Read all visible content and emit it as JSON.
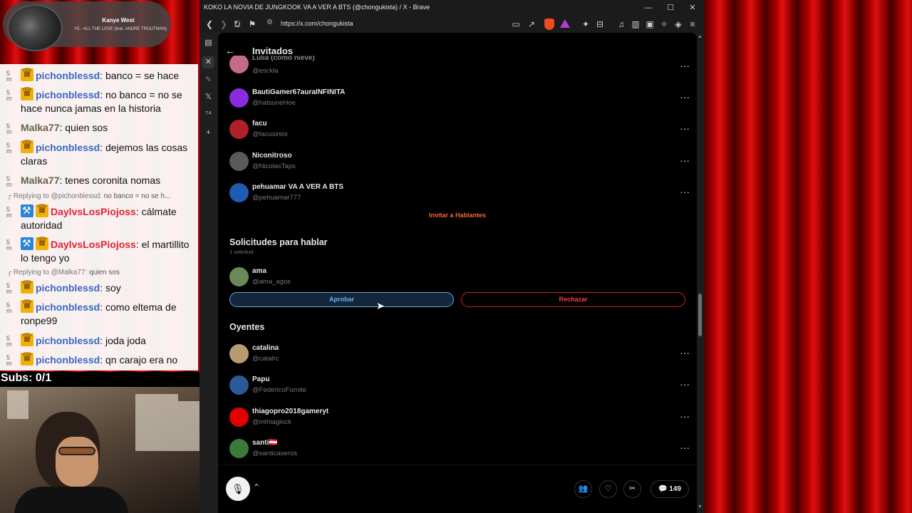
{
  "now_playing": {
    "artist": "Kanye West",
    "track": "YE - ALL THE LOVE (feat. ANDRE TROUTMAN)"
  },
  "chat": {
    "messages": [
      {
        "time": "5 m",
        "user": "pichonblessd",
        "text": "banco = se hace",
        "color": "#3a66c4",
        "badges": [
          "crown"
        ]
      },
      {
        "time": "5 m",
        "user": "pichonblessd",
        "text": "no banco = no se hace nunca jamas en la historia",
        "color": "#3a66c4",
        "badges": [
          "crown"
        ]
      },
      {
        "time": "5 m",
        "user": "Malka77",
        "text": "quien sos",
        "color": "#6b6048",
        "badges": []
      },
      {
        "time": "5 m",
        "user": "pichonblessd",
        "text": "dejemos las cosas claras",
        "color": "#3a66c4",
        "badges": [
          "crown"
        ]
      },
      {
        "time": "5 m",
        "user": "Malka77",
        "text": "tenes coronita nomas",
        "color": "#6b6048",
        "badges": []
      },
      {
        "time": "5 m",
        "user": "DaylvsLosPiojoss",
        "text": "cálmate autoridad",
        "color": "#e02233",
        "badges": [
          "hammer",
          "crown"
        ],
        "reply": {
          "prefix": "Replying to @pichonblessd:",
          "quote": "no banco = no se h..."
        }
      },
      {
        "time": "5 m",
        "user": "DaylvsLosPiojoss",
        "text": "el martillito lo tengo yo",
        "color": "#e02233",
        "badges": [
          "hammer",
          "crown"
        ]
      },
      {
        "time": "5 m",
        "user": "pichonblessd",
        "text": "soy",
        "color": "#3a66c4",
        "badges": [
          "crown"
        ],
        "reply": {
          "prefix": "Replying to @Malka77:",
          "quote": "quien sos"
        }
      },
      {
        "time": "5 m",
        "user": "pichonblessd",
        "text": "como eltema de ronpe99",
        "color": "#3a66c4",
        "badges": [
          "crown"
        ]
      },
      {
        "time": "5 m",
        "user": "pichonblessd",
        "text": "joda joda",
        "color": "#3a66c4",
        "badges": [
          "crown"
        ]
      },
      {
        "time": "5 m",
        "user": "pichonblessd",
        "text": "qn carajo era no",
        "color": "#3a66c4",
        "badges": [
          "crown"
        ]
      }
    ],
    "subs": "Subs: 0/1"
  },
  "browser": {
    "title": "KOKO LA NOVIA DE JUNGKOOK VA A VER A BTS (@chongukista) / X - Brave",
    "url": "https://x.com/chongukista",
    "controls": {
      "minimize": "—",
      "maximize": "☐",
      "close": "✕"
    }
  },
  "space": {
    "header_title": "Invitados",
    "top_partial": {
      "name": "Lulia (como nieve)",
      "handle": "@esckla"
    },
    "speakers": [
      {
        "name": "BautiGamer67auraINFINITA",
        "handle": "@hatsuneHoe",
        "avatar": "#8a2be2"
      },
      {
        "name": "facu",
        "handle": "@facusireix",
        "avatar": "#b0202a"
      },
      {
        "name": "Niconitroso",
        "handle": "@NicolasTaps",
        "avatar": "#5a5a5a"
      },
      {
        "name": "pehuamar VA A VER A BTS",
        "handle": "@pehuamar777",
        "avatar": "#1e5cb0"
      }
    ],
    "invite_link": "Invitar a Hablantes",
    "requests": {
      "title": "Solicitudes para hablar",
      "count": "1 solicitud",
      "user": {
        "name": "ama",
        "handle": "@ama_agos",
        "avatar": "#6a8a5a"
      },
      "approve": "Aprobar",
      "reject": "Rechazar"
    },
    "listeners": {
      "title": "Oyentes",
      "items": [
        {
          "name": "catalina",
          "handle": "@catalrc",
          "avatar": "#b89a70"
        },
        {
          "name": "Papu",
          "handle": "@FedericoFornite",
          "avatar": "#2a5a9a"
        },
        {
          "name": "thiagopro2018gameryt",
          "handle": "@mthiaglock",
          "avatar": "#e00000"
        },
        {
          "name": "santi🇦🇹",
          "handle": "@santicaseros",
          "avatar": "#3a7a3a"
        }
      ]
    },
    "listener_count": "149"
  },
  "accent_colors": {
    "x_orange": "#f26c2a",
    "approve_blue": "#6ab0ee",
    "reject_red": "#ff3b3b"
  }
}
